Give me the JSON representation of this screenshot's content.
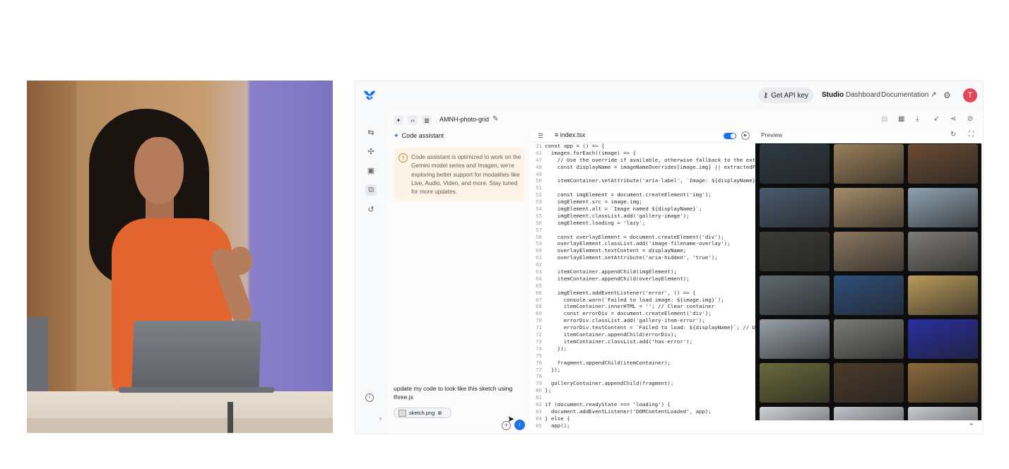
{
  "topbar": {
    "api_key_label": "Get API key",
    "nav": [
      "Studio",
      "Dashboard",
      "Documentation"
    ],
    "avatar_initial": "T"
  },
  "project": {
    "name": "AMNH-photo-grid"
  },
  "assistant": {
    "title": "Code assistant",
    "notice": "Code assistant is optimized to work on the Gemini model series and Imagen, we're exploring better support for modalities like Live, Audio, Video, and more. Stay tuned for more updates.",
    "prompt": "update my code to look like this sketch using three.js",
    "attachment": "sketch.png"
  },
  "editor": {
    "file_tab": "index.tsx",
    "lines": [
      {
        "n": "21",
        "t": "const app = () => {"
      },
      {
        "n": "41",
        "t": "  images.forEach((image) => {"
      },
      {
        "n": "47",
        "t": "    // Use the override if available, otherwise fallback to the ext"
      },
      {
        "n": "48",
        "t": "    const displayName = imageNameOverrides[image.img] || extractedF"
      },
      {
        "n": "49",
        "t": ""
      },
      {
        "n": "50",
        "t": "    itemContainer.setAttribute('aria-label', `Image: ${displayName}"
      },
      {
        "n": "51",
        "t": ""
      },
      {
        "n": "52",
        "t": "    const imgElement = document.createElement('img');"
      },
      {
        "n": "53",
        "t": "    imgElement.src = image.img;"
      },
      {
        "n": "54",
        "t": "    imgElement.alt = `Image named ${displayName}`;"
      },
      {
        "n": "55",
        "t": "    imgElement.classList.add('gallery-image');"
      },
      {
        "n": "56",
        "t": "    imgElement.loading = 'lazy';"
      },
      {
        "n": "57",
        "t": ""
      },
      {
        "n": "58",
        "t": "    const overlayElement = document.createElement('div');"
      },
      {
        "n": "59",
        "t": "    overlayElement.classList.add('image-filename-overlay');"
      },
      {
        "n": "60",
        "t": "    overlayElement.textContent = displayName;"
      },
      {
        "n": "61",
        "t": "    overlayElement.setAttribute('aria-hidden', 'true');"
      },
      {
        "n": "62",
        "t": ""
      },
      {
        "n": "63",
        "t": "    itemContainer.appendChild(imgElement);"
      },
      {
        "n": "64",
        "t": "    itemContainer.appendChild(overlayElement);"
      },
      {
        "n": "65",
        "t": ""
      },
      {
        "n": "66",
        "t": "    imgElement.addEventListener('error', () => {"
      },
      {
        "n": "67",
        "t": "      console.warn(`Failed to load image: ${image.img}`);"
      },
      {
        "n": "68",
        "t": "      itemContainer.innerHTML = ''; // Clear container"
      },
      {
        "n": "69",
        "t": "      const errorDiv = document.createElement('div');"
      },
      {
        "n": "70",
        "t": "      errorDiv.classList.add('gallery-item-error');"
      },
      {
        "n": "71",
        "t": "      errorDiv.textContent = `Failed to load: ${displayName}`; // U"
      },
      {
        "n": "72",
        "t": "      itemContainer.appendChild(errorDiv);"
      },
      {
        "n": "73",
        "t": "      itemContainer.classList.add('has-error');"
      },
      {
        "n": "74",
        "t": "    });"
      },
      {
        "n": "75",
        "t": ""
      },
      {
        "n": "76",
        "t": "    fragment.appendChild(itemContainer);"
      },
      {
        "n": "77",
        "t": "  });"
      },
      {
        "n": "78",
        "t": ""
      },
      {
        "n": "79",
        "t": "  galleryContainer.appendChild(fragment);"
      },
      {
        "n": "80",
        "t": "};"
      },
      {
        "n": "81",
        "t": ""
      },
      {
        "n": "82",
        "t": "if (document.readyState === 'loading') {"
      },
      {
        "n": "83",
        "t": "  document.addEventListener('DOMContentLoaded', app);"
      },
      {
        "n": "84",
        "t": "} else {"
      },
      {
        "n": "85",
        "t": "  app();"
      }
    ]
  },
  "preview": {
    "title": "Preview",
    "tile_colors": [
      "#2f3a44",
      "#9b7f5a",
      "#6b4b33",
      "#4a5a6e",
      "#a58c68",
      "#8ea1b0",
      "#3b3b36",
      "#8a7661",
      "#7d7b77",
      "#5f6a70",
      "#2f4f7a",
      "#b99a5a",
      "#98a0a8",
      "#7a7a74",
      "#2a2fa0",
      "#6a6a3a",
      "#4d3a2a",
      "#8b6a3d",
      "#cfd2d6",
      "#bfc4c9",
      "#c8cccf"
    ]
  },
  "colors": {
    "accent": "#1a73e8",
    "notice_bg": "#fdf3e7",
    "avatar": "#e2475a"
  }
}
